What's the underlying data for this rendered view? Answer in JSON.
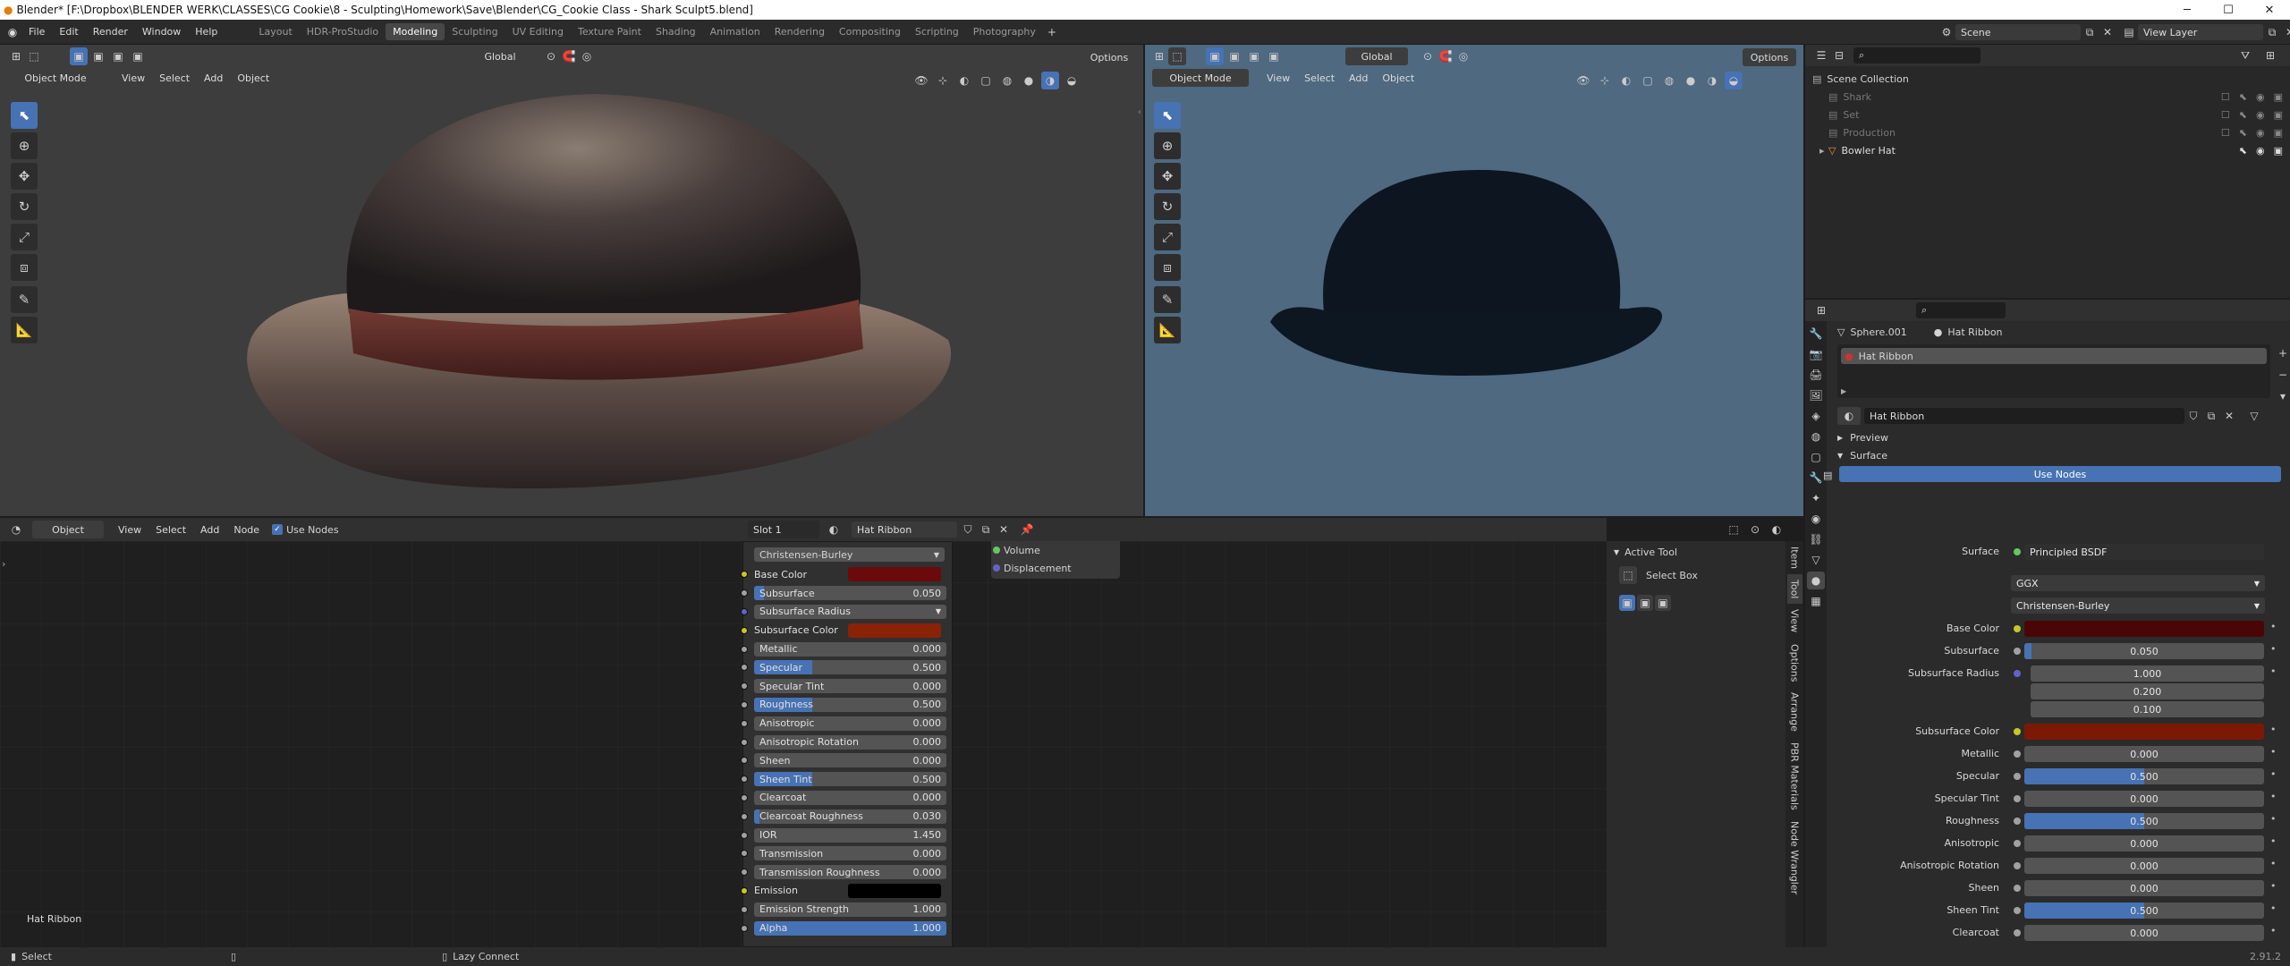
{
  "window": {
    "title": "Blender* [F:\\Dropbox\\BLENDER WERK\\CLASSES\\CG Cookie\\8 - Sculpting\\Homework\\Save\\Blender\\CG_Cookie Class - Shark Sculpt5.blend]",
    "minimize": "─",
    "maximize": "☐",
    "close": "✕"
  },
  "topbar": {
    "menus": [
      "File",
      "Edit",
      "Render",
      "Window",
      "Help"
    ],
    "workspaces": [
      "Layout",
      "HDR-ProStudio",
      "Modeling",
      "Sculpting",
      "UV Editing",
      "Texture Paint",
      "Shading",
      "Animation",
      "Rendering",
      "Compositing",
      "Scripting",
      "Photography"
    ],
    "active_workspace": "Modeling",
    "add_tab": "+",
    "scene": "Scene",
    "view_layer": "View Layer"
  },
  "viewport_left": {
    "mode": "Object Mode",
    "menus": [
      "View",
      "Select",
      "Add",
      "Object"
    ],
    "orientation": "Global",
    "options": "Options"
  },
  "viewport_right": {
    "mode": "Object Mode",
    "menus": [
      "View",
      "Select",
      "Add",
      "Object"
    ],
    "orientation": "Global",
    "options": "Options"
  },
  "node_editor": {
    "type": "Object",
    "menus": [
      "View",
      "Select",
      "Add",
      "Node"
    ],
    "use_nodes_label": "Use Nodes",
    "slot": "Slot 1",
    "material": "Hat Ribbon",
    "footer_label": "Hat Ribbon",
    "outputs": [
      "Volume",
      "Displacement"
    ],
    "node": {
      "distribution": "Christensen-Burley",
      "rows": [
        {
          "label": "Base Color",
          "kind": "color",
          "color": "#6b0a0a",
          "socket": "#c7c729"
        },
        {
          "label": "Subsurface",
          "value": "0.050",
          "fill": 0.05,
          "socket": "#a1a1a1"
        },
        {
          "label": "Subsurface Radius",
          "kind": "dropdown",
          "socket": "#6363c7"
        },
        {
          "label": "Subsurface Color",
          "kind": "color",
          "color": "#8a2208",
          "socket": "#c7c729"
        },
        {
          "label": "Metallic",
          "value": "0.000",
          "fill": 0,
          "socket": "#a1a1a1"
        },
        {
          "label": "Specular",
          "value": "0.500",
          "fill": 0.3,
          "socket": "#a1a1a1"
        },
        {
          "label": "Specular Tint",
          "value": "0.000",
          "fill": 0,
          "socket": "#a1a1a1"
        },
        {
          "label": "Roughness",
          "value": "0.500",
          "fill": 0.3,
          "socket": "#a1a1a1"
        },
        {
          "label": "Anisotropic",
          "value": "0.000",
          "fill": 0,
          "socket": "#a1a1a1"
        },
        {
          "label": "Anisotropic Rotation",
          "value": "0.000",
          "fill": 0,
          "socket": "#a1a1a1"
        },
        {
          "label": "Sheen",
          "value": "0.000",
          "fill": 0,
          "socket": "#a1a1a1"
        },
        {
          "label": "Sheen Tint",
          "value": "0.500",
          "fill": 0.3,
          "socket": "#a1a1a1"
        },
        {
          "label": "Clearcoat",
          "value": "0.000",
          "fill": 0,
          "socket": "#a1a1a1"
        },
        {
          "label": "Clearcoat Roughness",
          "value": "0.030",
          "fill": 0.03,
          "socket": "#a1a1a1"
        },
        {
          "label": "IOR",
          "value": "1.450",
          "fill": 0,
          "socket": "#a1a1a1"
        },
        {
          "label": "Transmission",
          "value": "0.000",
          "fill": 0,
          "socket": "#a1a1a1"
        },
        {
          "label": "Transmission Roughness",
          "value": "0.000",
          "fill": 0,
          "socket": "#a1a1a1"
        },
        {
          "label": "Emission",
          "kind": "color",
          "color": "#000000",
          "socket": "#c7c729"
        },
        {
          "label": "Emission Strength",
          "value": "1.000",
          "fill": 0,
          "socket": "#a1a1a1"
        },
        {
          "label": "Alpha",
          "value": "1.000",
          "fill": 1,
          "socket": "#a1a1a1"
        }
      ]
    },
    "sidebar": {
      "active_tool_title": "Active Tool",
      "tool": "Select Box",
      "tabs": [
        "Item",
        "Tool",
        "View",
        "Options",
        "Arrange",
        "PBR Materials",
        "Node Wrangler"
      ]
    }
  },
  "outliner": {
    "root": "Scene Collection",
    "items": [
      {
        "label": "Shark",
        "dim": true
      },
      {
        "label": "Set",
        "dim": true
      },
      {
        "label": "Production",
        "dim": true
      },
      {
        "label": "Bowler Hat",
        "dim": false
      }
    ]
  },
  "properties": {
    "object": "Sphere.001",
    "material_tab": "Hat Ribbon",
    "slot_item": "Hat Ribbon",
    "material": "Hat Ribbon",
    "preview_label": "Preview",
    "surface_label": "Surface",
    "use_nodes_label": "Use Nodes",
    "surface_shader_label": "Surface",
    "surface_shader": "Principled BSDF",
    "distribution": "GGX",
    "subsurface_method": "Christensen-Burley",
    "rows": [
      {
        "label": "Base Color",
        "kind": "color",
        "color": "#4a0606",
        "dot": "#c7c729"
      },
      {
        "label": "Subsurface",
        "value": "0.050",
        "fill": 0.03,
        "dot": "#a1a1a1"
      },
      {
        "label": "Subsurface Radius",
        "kind": "vector",
        "values": [
          "1.000",
          "0.200",
          "0.100"
        ],
        "dot": "#6363c7"
      },
      {
        "label": "Subsurface Color",
        "kind": "color",
        "color": "#7a1a05",
        "dot": "#c7c729"
      },
      {
        "label": "Metallic",
        "value": "0.000",
        "fill": 0,
        "dot": "#a1a1a1"
      },
      {
        "label": "Specular",
        "value": "0.500",
        "fill": 0.5,
        "dot": "#a1a1a1"
      },
      {
        "label": "Specular Tint",
        "value": "0.000",
        "fill": 0,
        "dot": "#a1a1a1"
      },
      {
        "label": "Roughness",
        "value": "0.500",
        "fill": 0.5,
        "dot": "#a1a1a1"
      },
      {
        "label": "Anisotropic",
        "value": "0.000",
        "fill": 0,
        "dot": "#a1a1a1"
      },
      {
        "label": "Anisotropic Rotation",
        "value": "0.000",
        "fill": 0,
        "dot": "#a1a1a1"
      },
      {
        "label": "Sheen",
        "value": "0.000",
        "fill": 0,
        "dot": "#a1a1a1"
      },
      {
        "label": "Sheen Tint",
        "value": "0.500",
        "fill": 0.5,
        "dot": "#a1a1a1"
      },
      {
        "label": "Clearcoat",
        "value": "0.000",
        "fill": 0,
        "dot": "#a1a1a1"
      }
    ]
  },
  "statusbar": {
    "left": "Select",
    "middle": "Lazy Connect",
    "version": "2.91.2"
  }
}
